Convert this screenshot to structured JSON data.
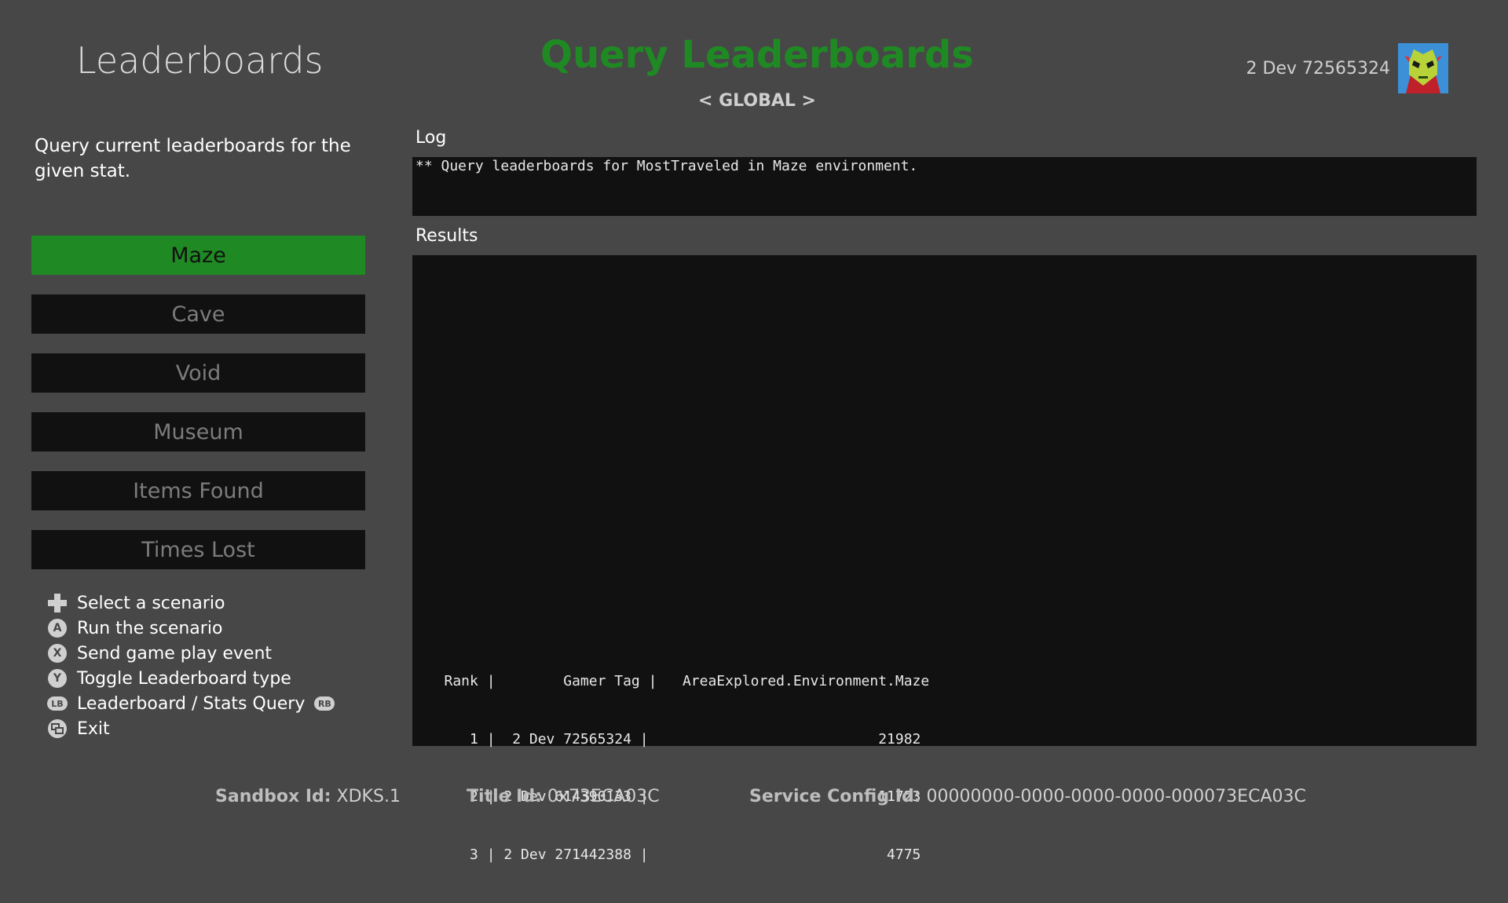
{
  "header": {
    "app_title": "Leaderboards",
    "page_title": "Query Leaderboards",
    "scope": "< GLOBAL >",
    "user_name": "2 Dev 72565324"
  },
  "description": "Query current leaderboards for the given stat.",
  "menu": {
    "items": [
      {
        "label": "Maze",
        "active": true
      },
      {
        "label": "Cave",
        "active": false
      },
      {
        "label": "Void",
        "active": false
      },
      {
        "label": "Museum",
        "active": false
      },
      {
        "label": "Items Found",
        "active": false
      },
      {
        "label": "Times Lost",
        "active": false
      }
    ]
  },
  "help": [
    {
      "icon": "dpad-icon",
      "label": "Select a scenario"
    },
    {
      "icon": "a-button-icon",
      "glyph": "A",
      "label": "Run the scenario"
    },
    {
      "icon": "x-button-icon",
      "glyph": "X",
      "label": "Send game play event"
    },
    {
      "icon": "y-button-icon",
      "glyph": "Y",
      "label": "Toggle Leaderboard type"
    },
    {
      "icon": "lb-button-icon",
      "glyph": "LB",
      "label": "Leaderboard / Stats Query",
      "trailing_icon": "rb-button-icon",
      "trailing_glyph": "RB"
    },
    {
      "icon": "view-button-icon",
      "label": "Exit"
    }
  ],
  "log": {
    "label": "Log",
    "lines": [
      "** Query leaderboards for MostTraveled in Maze environment."
    ]
  },
  "results": {
    "label": "Results",
    "lines": [
      "   Rank |        Gamer Tag |   AreaExplored.Environment.Maze",
      "      1 |  2 Dev 72565324 |                           21982",
      "      2 | 2 Dev 614390133 |                           11723",
      "      3 | 2 Dev 271442388 |                            4775"
    ]
  },
  "footer": {
    "sandbox_key": "Sandbox Id:",
    "sandbox_val": "XDKS.1",
    "title_key": "Title Id:",
    "title_val": "0x73ECA03C",
    "scid_key": "Service Config Id:",
    "scid_val": "00000000-0000-0000-0000-000073ECA03C"
  },
  "colors": {
    "background": "#474747",
    "accent_green": "#1f8a23",
    "panel": "#111111"
  }
}
